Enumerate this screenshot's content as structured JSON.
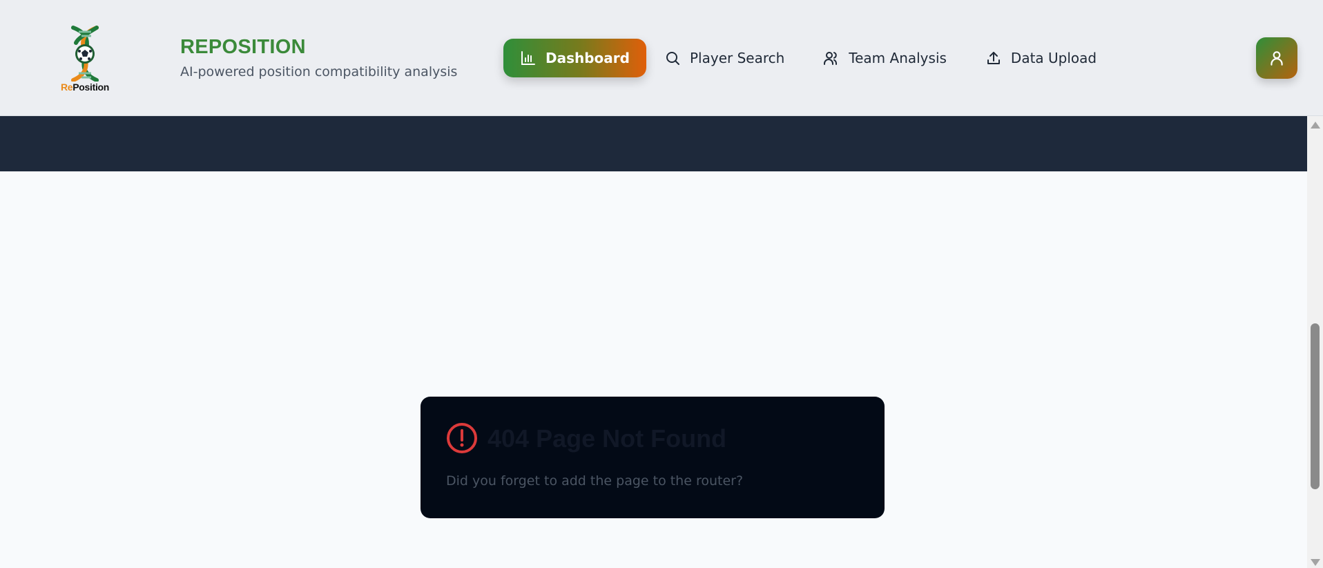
{
  "header": {
    "logo_text_re": "Re",
    "logo_text_position": "Position",
    "title": "REPOSITION",
    "subtitle": "AI-powered position compatibility analysis"
  },
  "nav": {
    "items": [
      {
        "label": "Dashboard",
        "icon": "bar-chart-icon",
        "active": true
      },
      {
        "label": "Player Search",
        "icon": "search-icon",
        "active": false
      },
      {
        "label": "Team Analysis",
        "icon": "users-icon",
        "active": false
      },
      {
        "label": "Data Upload",
        "icon": "upload-icon",
        "active": false
      }
    ]
  },
  "user_button": {
    "icon": "user-icon"
  },
  "error": {
    "icon": "alert-circle-icon",
    "title": "404 Page Not Found",
    "message": "Did you forget to add the page to the router?"
  },
  "colors": {
    "brand_green": "#3b8a3a",
    "brand_orange": "#e05f0a",
    "header_bg": "#eceef2",
    "dark_band": "#1e293b",
    "card_bg": "#030a16",
    "error_red": "#dc3a3a"
  }
}
